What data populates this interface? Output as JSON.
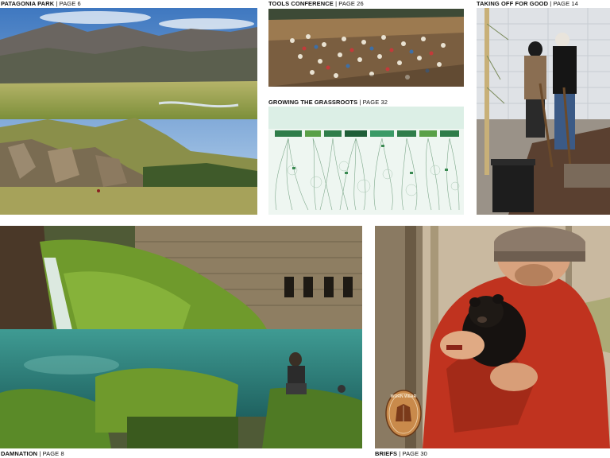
{
  "stories": [
    {
      "title": "PATAGONIA PARK",
      "page": "| PAGE 6"
    },
    {
      "title": "TOOLS CONFERENCE",
      "page": "| PAGE 26"
    },
    {
      "title": "GROWING THE GRASSROOTS",
      "page": "| PAGE 32"
    },
    {
      "title": "TAKING OFF FOR GOOD",
      "page": "| PAGE 14"
    },
    {
      "title": "DAMNATION",
      "page": "| PAGE 8"
    },
    {
      "title": "BRIEFS",
      "page": "| PAGE 30"
    }
  ],
  "worn_wear_badge": "WORN WEAR",
  "colors": {
    "text": "#111111",
    "badge_fill": "#c98a4b",
    "jacket_red": "#c0331f",
    "lake_teal": "#2f8f88",
    "moss_green": "#6f9a2c"
  }
}
